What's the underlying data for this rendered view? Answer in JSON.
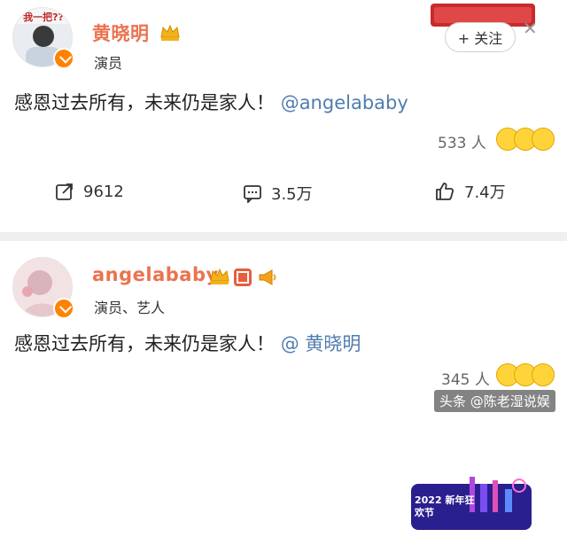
{
  "post1": {
    "avatar_banner": "我一把??",
    "name": "黄晓明",
    "role": "演员",
    "follow_label": "+ 关注",
    "content_text": "感恩过去所有，未来仍是家人！",
    "content_mention": "@angelababy",
    "like_count": "533 人",
    "actions": {
      "repost_count": "9612",
      "comment_count": "3.5万",
      "like_count": "7.4万"
    }
  },
  "post2": {
    "name": "angelababy",
    "role": "演员、艺人",
    "badge_text": "2022 新年狂欢节",
    "content_text": "感恩过去所有，未来仍是家人！",
    "content_mention": "@ 黄晓明",
    "like_count": "345 人"
  },
  "watermark": "头条 @陈老湿说娱",
  "colors": {
    "name": "#eb7350",
    "mention": "#507daf",
    "verified": "#ff8200"
  }
}
